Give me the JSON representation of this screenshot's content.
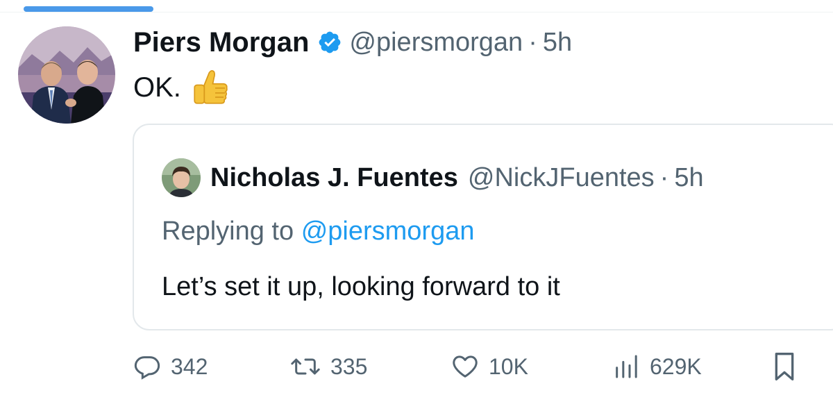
{
  "tweet": {
    "author": {
      "display_name": "Piers Morgan",
      "handle": "@piersmorgan",
      "verified": true,
      "verified_icon": "verified-badge-icon"
    },
    "separator": "·",
    "time": "5h",
    "text": "OK.",
    "emoji": "thumbs-up"
  },
  "quoted_tweet": {
    "author": {
      "display_name": "Nicholas J. Fuentes",
      "handle": "@NickJFuentes"
    },
    "separator": "·",
    "time": "5h",
    "replying_prefix": "Replying to",
    "replying_to": "@piersmorgan",
    "text": "Let’s set it up, looking forward to it"
  },
  "actions": {
    "replies": "342",
    "retweets": "335",
    "likes": "10K",
    "views": "629K"
  },
  "colors": {
    "accent": "#1d9bf0",
    "tab_indicator": "#4a99e9",
    "secondary_text": "#536471",
    "primary_text": "#0f1419"
  }
}
